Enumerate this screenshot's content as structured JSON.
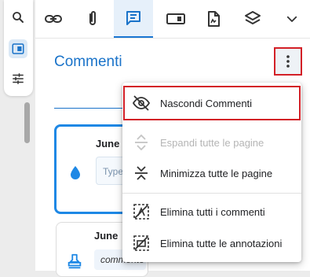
{
  "panel": {
    "title": "Commenti"
  },
  "menu": {
    "items": [
      {
        "label": "Nascondi Commenti",
        "icon": "eye-off-icon",
        "disabled": false
      },
      {
        "label": "Espandi tutte le pagine",
        "icon": "expand-icon",
        "disabled": true
      },
      {
        "label": "Minimizza tutte le pagine",
        "icon": "collapse-icon",
        "disabled": false
      },
      {
        "label": "Elimina tutti i commenti",
        "icon": "delete-comments-icon",
        "disabled": false
      },
      {
        "label": "Elimina tutte le annotazioni",
        "icon": "delete-annotations-icon",
        "disabled": false
      }
    ]
  },
  "cards": [
    {
      "author": "June",
      "input_placeholder": "Type",
      "icon": "water-drop-icon"
    },
    {
      "author": "June",
      "comment": "commento",
      "icon": "stamp-icon"
    }
  ],
  "colors": {
    "accent": "#1a73c9",
    "highlight": "#d32027"
  }
}
